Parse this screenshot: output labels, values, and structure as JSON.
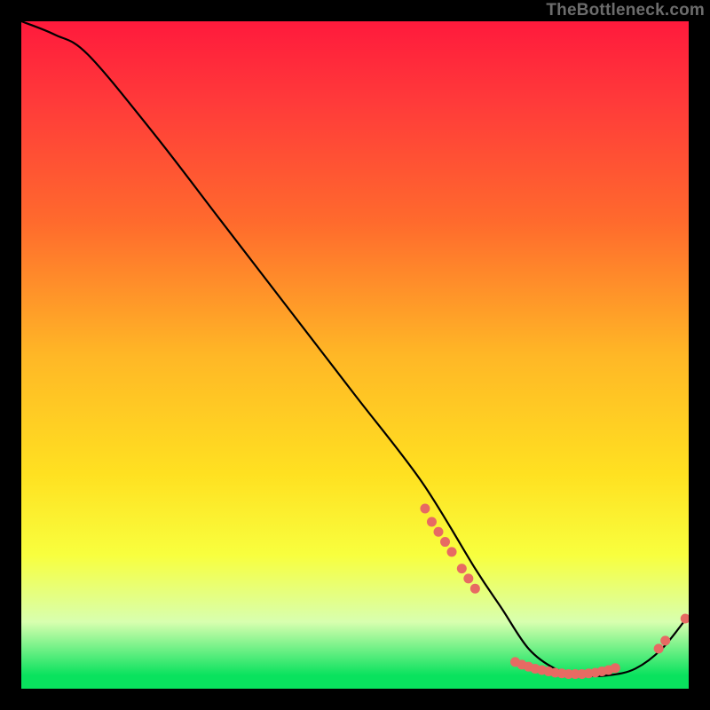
{
  "watermark": "TheBottleneck.com",
  "chart_data": {
    "type": "line",
    "title": "",
    "xlabel": "",
    "ylabel": "",
    "xlim": [
      0,
      100
    ],
    "ylim": [
      0,
      100
    ],
    "series": [
      {
        "name": "curve",
        "x": [
          0,
          5,
          10,
          20,
          30,
          40,
          50,
          60,
          68,
          72,
          76,
          80,
          84,
          88,
          92,
          96,
          100
        ],
        "values": [
          100,
          98,
          95,
          83,
          70,
          57,
          44,
          31,
          18,
          12,
          6,
          3,
          2,
          2,
          3,
          6,
          11
        ]
      }
    ],
    "marker_clusters": [
      {
        "name": "left-cluster",
        "points": [
          {
            "x": 60.5,
            "y": 27
          },
          {
            "x": 61.5,
            "y": 25
          },
          {
            "x": 62.5,
            "y": 23.5
          },
          {
            "x": 63.5,
            "y": 22
          },
          {
            "x": 64.5,
            "y": 20.5
          },
          {
            "x": 66.0,
            "y": 18
          },
          {
            "x": 67.0,
            "y": 16.5
          },
          {
            "x": 68.0,
            "y": 15
          }
        ]
      },
      {
        "name": "bottom-cluster",
        "points": [
          {
            "x": 74,
            "y": 4.0
          },
          {
            "x": 75,
            "y": 3.6
          },
          {
            "x": 76,
            "y": 3.3
          },
          {
            "x": 77,
            "y": 3.0
          },
          {
            "x": 78,
            "y": 2.8
          },
          {
            "x": 79,
            "y": 2.6
          },
          {
            "x": 80,
            "y": 2.4
          },
          {
            "x": 81,
            "y": 2.3
          },
          {
            "x": 82,
            "y": 2.2
          },
          {
            "x": 83,
            "y": 2.2
          },
          {
            "x": 84,
            "y": 2.2
          },
          {
            "x": 85,
            "y": 2.3
          },
          {
            "x": 86,
            "y": 2.4
          },
          {
            "x": 87,
            "y": 2.6
          },
          {
            "x": 88,
            "y": 2.8
          },
          {
            "x": 89,
            "y": 3.1
          }
        ]
      },
      {
        "name": "right-cluster",
        "points": [
          {
            "x": 95.5,
            "y": 6.0
          },
          {
            "x": 96.5,
            "y": 7.2
          },
          {
            "x": 99.5,
            "y": 10.5
          }
        ]
      }
    ],
    "colors": {
      "curve": "#000000",
      "markers": "#e76a63"
    }
  }
}
